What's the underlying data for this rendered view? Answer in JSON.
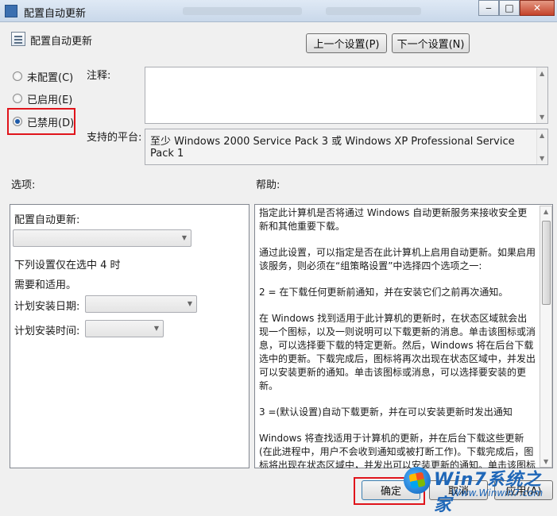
{
  "window": {
    "title": "配置自动更新",
    "controls": {
      "minimize": "‒",
      "maximize": "□",
      "close": "✕"
    }
  },
  "header": {
    "policy_name": "配置自动更新",
    "prev_button": "上一个设置(P)",
    "next_button": "下一个设置(N)"
  },
  "state_options": [
    {
      "label": "未配置(C)",
      "checked": false
    },
    {
      "label": "已启用(E)",
      "checked": false
    },
    {
      "label": "已禁用(D)",
      "checked": true
    }
  ],
  "comment": {
    "label": "注释:",
    "value": ""
  },
  "platform": {
    "label": "支持的平台:",
    "value": "至少 Windows 2000 Service Pack 3 或 Windows XP Professional Service Pack 1"
  },
  "options": {
    "heading": "选项:",
    "configure_label": "配置自动更新:",
    "configure_value": "",
    "note_line1": "下列设置仅在选中 4 时",
    "note_line2": "需要和适用。",
    "install_day_label": "计划安装日期:",
    "install_day_value": "",
    "install_time_label": "计划安装时间:",
    "install_time_value": ""
  },
  "help": {
    "heading": "帮助:",
    "paragraphs": [
      "指定此计算机是否将通过 Windows 自动更新服务来接收安全更新和其他重要下载。",
      "通过此设置，可以指定是否在此计算机上启用自动更新。如果启用该服务，则必须在“组策略设置”中选择四个选项之一:",
      "2 = 在下载任何更新前通知，并在安装它们之前再次通知。",
      "在 Windows 找到适用于此计算机的更新时，在状态区域就会出现一个图标，以及一则说明可以下载更新的消息。单击该图标或消息，可以选择要下载的特定更新。然后，Windows 将在后台下载选中的更新。下载完成后，图标将再次出现在状态区域中，并发出可以安装更新的通知。单击该图标或消息，可以选择要安装的更新。",
      "3 =(默认设置)自动下载更新，并在可以安装更新时发出通知",
      "Windows 将查找适用于计算机的更新，并在后台下载这些更新(在此进程中，用户不会收到通知或被打断工作)。下载完成后，图标将出现在状态区域中，并发出可以安装更新的通知。单击该图标或"
    ]
  },
  "footer": {
    "ok_button": "确定",
    "cancel_button": "取消",
    "apply_button": "应用(A)"
  },
  "watermark": {
    "brand": "Win7系统之家",
    "url": "Www.Winwin7.com"
  },
  "colors": {
    "highlight_box": "#e0141b",
    "accent": "#1d5aa8"
  }
}
